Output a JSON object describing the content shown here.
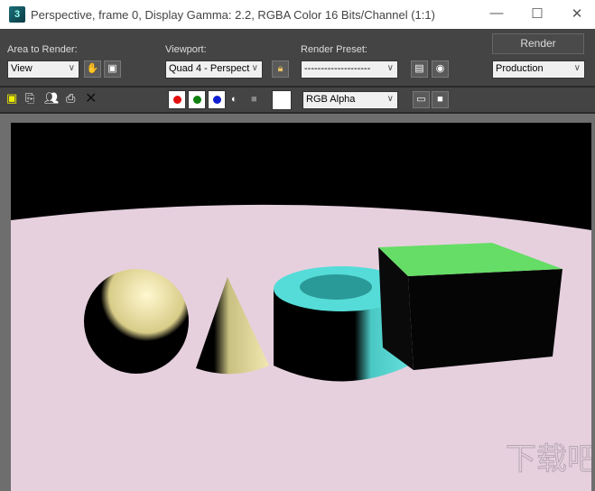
{
  "window": {
    "title": "Perspective, frame 0, Display Gamma: 2.2, RGBA Color 16 Bits/Channel (1:1)",
    "minimize": "—",
    "maximize": "☐",
    "close": "✕"
  },
  "toolbar": {
    "area_label": "Area to Render:",
    "area_value": "View",
    "viewport_label": "Viewport:",
    "viewport_value": "Quad 4 - Perspect",
    "preset_label": "Render Preset:",
    "preset_value": "--------------------",
    "render_button": "Render",
    "render_mode": "Production",
    "channel_value": "RGB Alpha"
  },
  "colors": {
    "red": "#e01010",
    "green": "#108010",
    "blue": "#1020d0",
    "floor": "#e6d0de",
    "box_top": "#66dd66",
    "tube": "#55dcd8",
    "cone": "#e8e0a0"
  },
  "watermark": "下载吧 www.xiazaiba.com"
}
